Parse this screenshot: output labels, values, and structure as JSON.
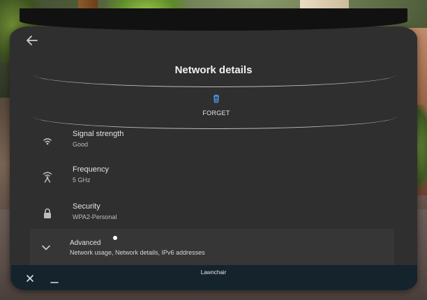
{
  "header": {
    "title": "Network details"
  },
  "actions": {
    "forget_label": "FORGET"
  },
  "details": [
    {
      "title": "Signal strength",
      "value": "Good",
      "icon": "wifi-icon"
    },
    {
      "title": "Frequency",
      "value": "5 GHz",
      "icon": "antenna-icon"
    },
    {
      "title": "Security",
      "value": "WPA2-Personal",
      "icon": "lock-icon"
    }
  ],
  "advanced": {
    "title": "Advanced",
    "subtitle": "Network usage, Network details, IPv6 addresses",
    "icon": "chevron-down-icon"
  },
  "window": {
    "app_name": "Lawnchair"
  },
  "colors": {
    "accent": "#4a8fe0",
    "panel": "#2f2f2f",
    "bottom_bar": "#15232c"
  }
}
